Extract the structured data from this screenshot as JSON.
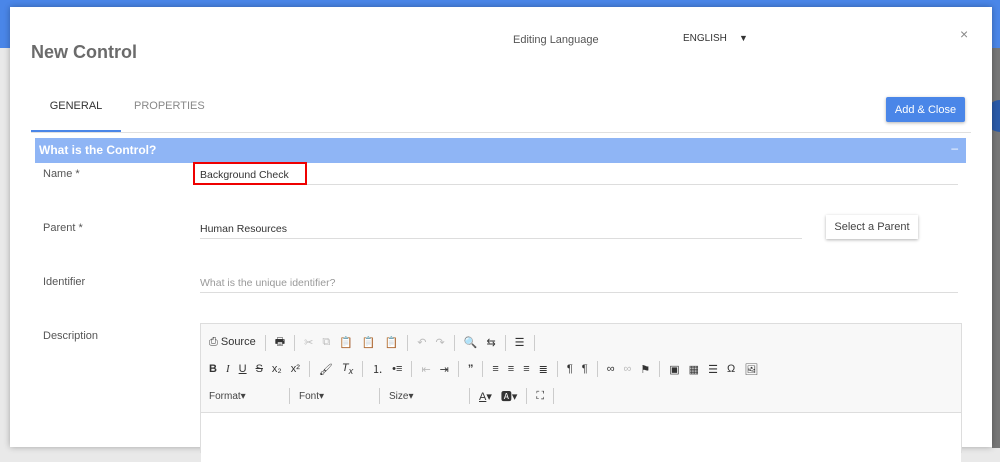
{
  "modal": {
    "title": "New Control",
    "editing_language_label": "Editing Language",
    "language": "ENGLISH",
    "close": "×"
  },
  "tabs": [
    {
      "label": "GENERAL"
    },
    {
      "label": "PROPERTIES"
    }
  ],
  "add_close": "Add & Close",
  "section": {
    "title": "What is the Control?",
    "collapse": "–"
  },
  "fields": {
    "name": {
      "label": "Name *",
      "value": "Background Check"
    },
    "parent": {
      "label": "Parent  *",
      "value": "Human Resources",
      "button": "Select a Parent"
    },
    "identifier": {
      "label": "Identifier",
      "placeholder": "What is the unique identifier?"
    },
    "description": {
      "label": "Description"
    }
  },
  "editor": {
    "source": "Source",
    "format": "Format",
    "font": "Font",
    "size": "Size"
  }
}
